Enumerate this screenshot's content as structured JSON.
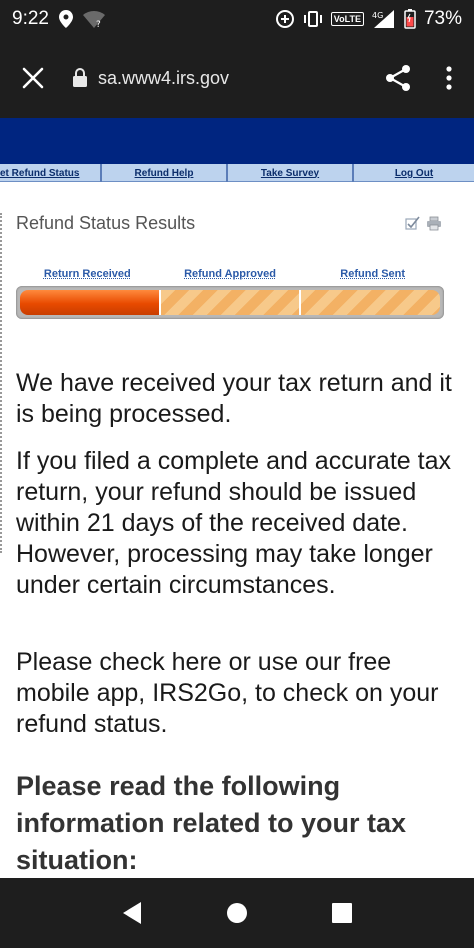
{
  "status_bar": {
    "time": "9:22",
    "network_label": "VoLTE",
    "signal_label": "4G",
    "battery": "73%"
  },
  "browser": {
    "url": "sa.www4.irs.gov",
    "icons": [
      "close-icon",
      "lock-icon",
      "share-icon",
      "more-vert-icon"
    ]
  },
  "nav": {
    "tabs": [
      "et Refund Status",
      "Refund Help",
      "Take Survey",
      "Log Out"
    ]
  },
  "page": {
    "title": "Refund Status Results",
    "tool_icons": [
      "check-icon",
      "print-icon"
    ],
    "progress": {
      "stages": [
        "Return Received",
        "Refund Approved",
        "Refund Sent"
      ],
      "completed_stages": 1
    },
    "messages": [
      "We have received your tax return and it is being processed.",
      "If you filed a complete and accurate tax return, your refund should be issued within 21 days of the received date. However, processing may take longer under certain circumstances.",
      "Please check here or use our free mobile app, IRS2Go, to check on your refund status."
    ],
    "heading": "Please read the following information related to your tax situation:"
  },
  "colors": {
    "irs_blue": "#002580",
    "nav_tab_bg": "#bdd3ee",
    "progress_done": "#e84a00",
    "progress_pending": "#f3b164"
  }
}
